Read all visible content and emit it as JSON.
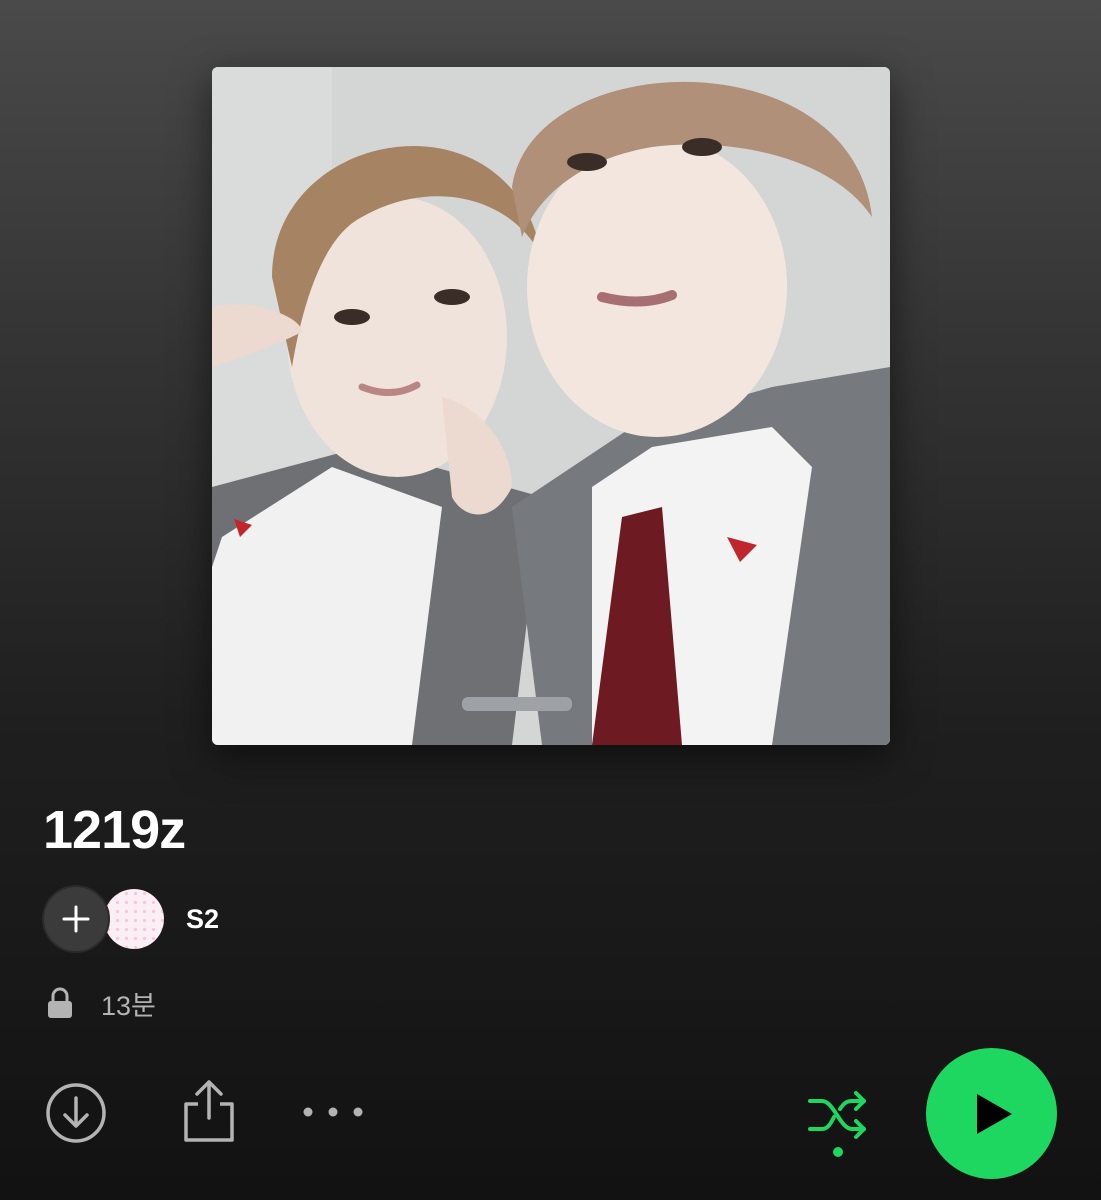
{
  "playlist": {
    "title": "1219z",
    "owner": "S2",
    "duration": "13분",
    "visibility": "private"
  },
  "icons": {
    "add_collaborator": "plus-icon",
    "privacy": "lock-icon",
    "download": "download-circle-icon",
    "share": "share-icon",
    "more": "more-dots-icon",
    "shuffle": "shuffle-icon",
    "play": "play-icon"
  },
  "colors": {
    "accent": "#1ed760",
    "secondary_text": "#b3b3b3",
    "background_top": "#4a4a4a",
    "background_bottom": "#121212"
  },
  "controls": {
    "shuffle_enabled": true
  }
}
